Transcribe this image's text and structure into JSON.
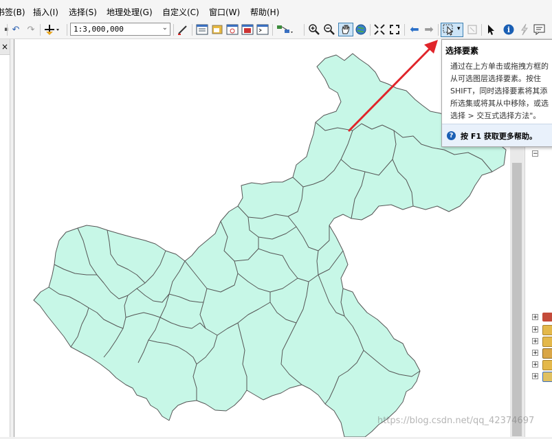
{
  "menus": [
    "书签(B)",
    "插入(I)",
    "选择(S)",
    "地理处理(G)",
    "自定义(C)",
    "窗口(W)",
    "帮助(H)"
  ],
  "toolbar": {
    "scale_value": "1:3,000,000",
    "icons": [
      "undo-icon",
      "redo-icon",
      "add-data-icon",
      "editor-icon",
      "zoom-in-icon",
      "zoom-out-icon",
      "pan-icon",
      "full-extent-icon",
      "select-features-icon",
      "select-elements-icon",
      "identify-icon"
    ]
  },
  "left_pane": {
    "close_label": "×"
  },
  "tooltip": {
    "title": "选择要素",
    "body_lines": [
      "通过在上方单击或拖拽方框的",
      "从可选图层选择要素。按住",
      "SHIFT，同时选择要素将其添",
      "所选集或将其从中移除，或选",
      "选择 > 交互式选择方法\"。"
    ],
    "help_icon_glyph": "?",
    "footer": "按 F1 获取更多帮助。"
  },
  "right_pane": {
    "expanders": [
      "−",
      "+",
      "+",
      "+",
      "+",
      "+",
      "+"
    ]
  },
  "map": {
    "fill_color": "#c7f7e7",
    "stroke_color": "#555555",
    "annotation_color": "#e0252b"
  },
  "watermark": "https://blog.csdn.net/qq_42374697"
}
